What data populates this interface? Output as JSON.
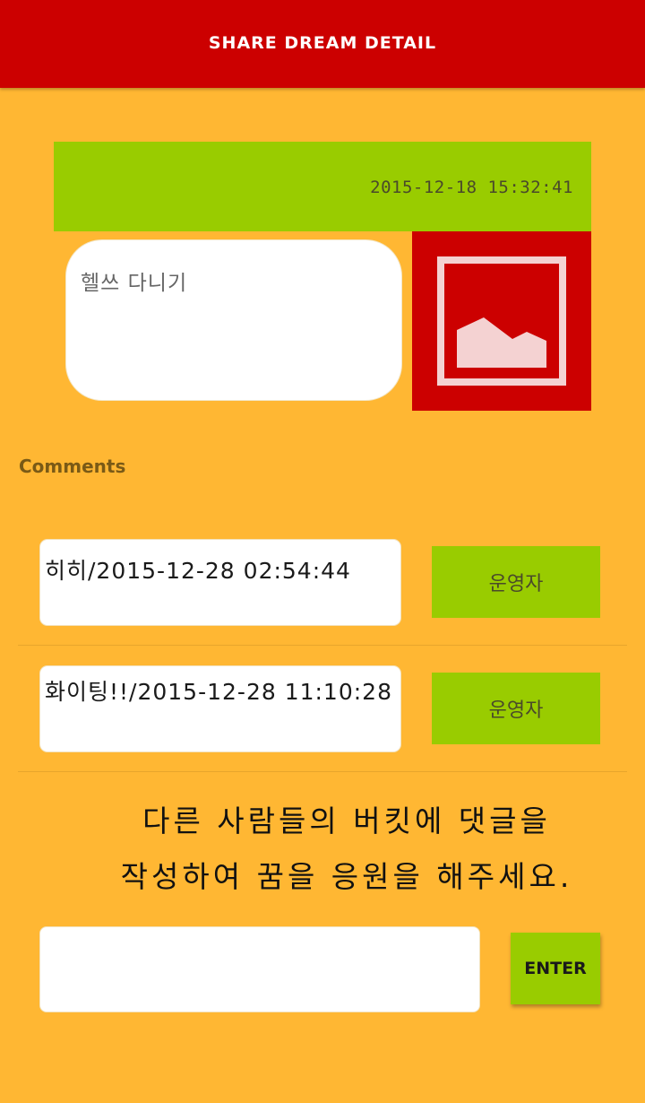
{
  "appbar": {
    "title": "SHARE DREAM DETAIL"
  },
  "dream": {
    "date": "2015-12-18 15:32:41",
    "text": "헬쓰 다니기",
    "image_icon": "image-placeholder-icon"
  },
  "comments_section": {
    "title": "Comments",
    "items": [
      {
        "text": "히히/2015-12-28 02:54:44",
        "author": "운영자"
      },
      {
        "text": "화이팅!!/2015-12-28 11:10:28",
        "author": "운영자"
      }
    ]
  },
  "prompt": {
    "line1": "다른 사람들의 버킷에 댓글을",
    "line2": "작성하여 꿈을 응원을 해주세요."
  },
  "input": {
    "value": "",
    "placeholder": "",
    "enter_label": "ENTER"
  },
  "colors": {
    "background": "#FFB733",
    "appbar": "#CC0000",
    "accent_green": "#99CC00",
    "image_bg": "#CC0000"
  }
}
